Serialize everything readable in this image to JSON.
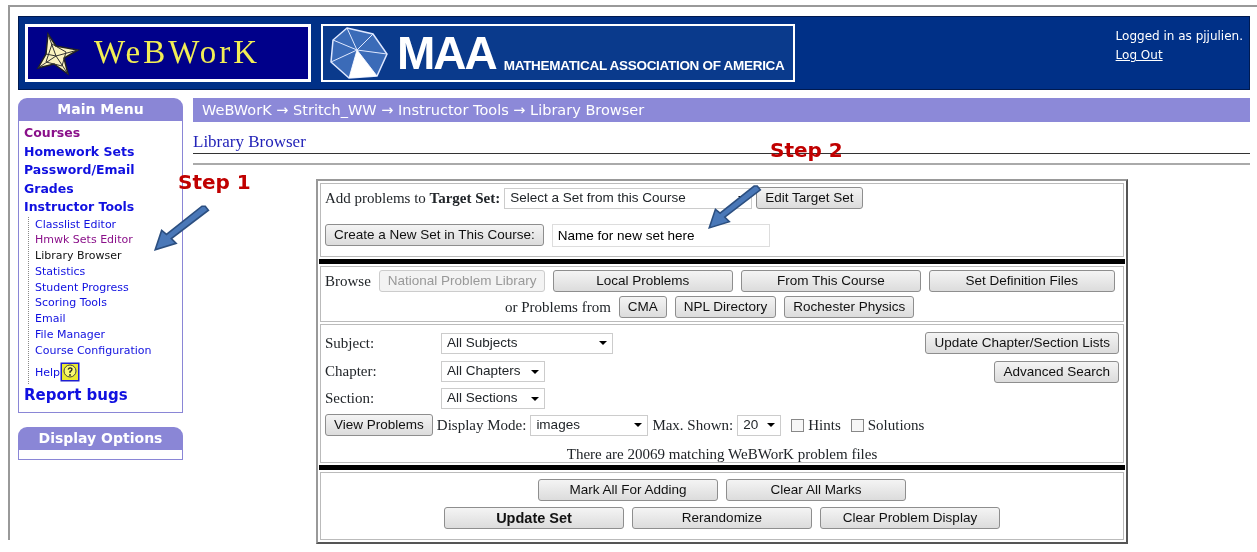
{
  "header": {
    "logo_text": "WeBWorK",
    "org_abbrev": "MAA",
    "org_name": "MATHEMATICAL ASSOCIATION OF AMERICA",
    "login_text": "Logged in as pjjulien.",
    "logout_link": "Log Out"
  },
  "sidebar": {
    "title": "Main Menu",
    "items": [
      {
        "label": "Courses",
        "visited": true,
        "selected": false
      },
      {
        "label": "Homework Sets",
        "visited": false,
        "selected": false
      },
      {
        "label": "Password/Email",
        "visited": false,
        "selected": false
      },
      {
        "label": "Grades",
        "visited": false,
        "selected": false
      },
      {
        "label": "Instructor Tools",
        "visited": false,
        "selected": false,
        "children": [
          {
            "label": "Classlist Editor",
            "visited": false,
            "selected": false
          },
          {
            "label": "Hmwk Sets Editor",
            "visited": true,
            "selected": false
          },
          {
            "label": "Library Browser",
            "visited": false,
            "selected": true
          },
          {
            "label": "Statistics",
            "visited": false,
            "selected": false
          },
          {
            "label": "Student Progress",
            "visited": false,
            "selected": false
          },
          {
            "label": "Scoring Tools",
            "visited": false,
            "selected": false
          },
          {
            "label": "Email",
            "visited": false,
            "selected": false
          },
          {
            "label": "File Manager",
            "visited": false,
            "selected": false
          },
          {
            "label": "Course Configuration",
            "visited": false,
            "selected": false
          },
          {
            "label": "Help",
            "visited": false,
            "selected": false,
            "kind": "help"
          }
        ]
      },
      {
        "label": "Report bugs",
        "visited": false,
        "selected": false,
        "kind": "large"
      }
    ]
  },
  "display_options": {
    "title": "Display Options"
  },
  "breadcrumb": "WeBWorK → Stritch_WW → Instructor Tools → Library Browser",
  "page_title": "Library Browser",
  "target": {
    "label": "Add problems to **Target Set:**",
    "select_value": "Select a Set from this Course",
    "edit_button": "Edit Target Set",
    "create_button": "Create a New Set in This Course:",
    "new_set_value": "Name for new set here"
  },
  "browse": {
    "label": "Browse",
    "buttons": [
      {
        "label": "National Problem Library",
        "disabled": true
      },
      {
        "label": "Local Problems",
        "disabled": false
      },
      {
        "label": "From This Course",
        "disabled": false
      },
      {
        "label": "Set Definition Files",
        "disabled": false
      }
    ],
    "or_label": "or Problems from",
    "sources": [
      {
        "label": "CMA",
        "disabled": false
      },
      {
        "label": "NPL Directory",
        "disabled": false
      },
      {
        "label": "Rochester Physics",
        "disabled": false
      }
    ]
  },
  "search": {
    "fields": [
      {
        "label": "Subject:",
        "value": "All Subjects",
        "kind": "wide"
      },
      {
        "label": "Chapter:",
        "value": "All Chapters",
        "kind": "narrow"
      },
      {
        "label": "Section:",
        "value": "All Sections",
        "kind": "narrow"
      }
    ],
    "update_button": "Update Chapter/Section Lists",
    "advanced_button": "Advanced Search",
    "view_button": "View Problems",
    "display_mode_label": "Display Mode:",
    "display_mode_value": "images",
    "max_shown_label": "Max. Shown:",
    "max_shown_value": "20",
    "options": [
      {
        "label": "Hints",
        "checked": false
      },
      {
        "label": "Solutions",
        "checked": false
      }
    ],
    "match_text": "There are 20069 matching WeBWorK problem files"
  },
  "actions": [
    [
      {
        "label": "Mark All For Adding",
        "kind": "normal"
      },
      {
        "label": "Clear All Marks",
        "kind": "normal"
      }
    ],
    [
      {
        "label": "Update Set",
        "kind": "primary"
      },
      {
        "label": "Rerandomize",
        "kind": "normal"
      },
      {
        "label": "Clear Problem Display",
        "kind": "normal"
      }
    ]
  ],
  "annotations": [
    {
      "text": "Step 1"
    },
    {
      "text": "Step 2"
    }
  ]
}
